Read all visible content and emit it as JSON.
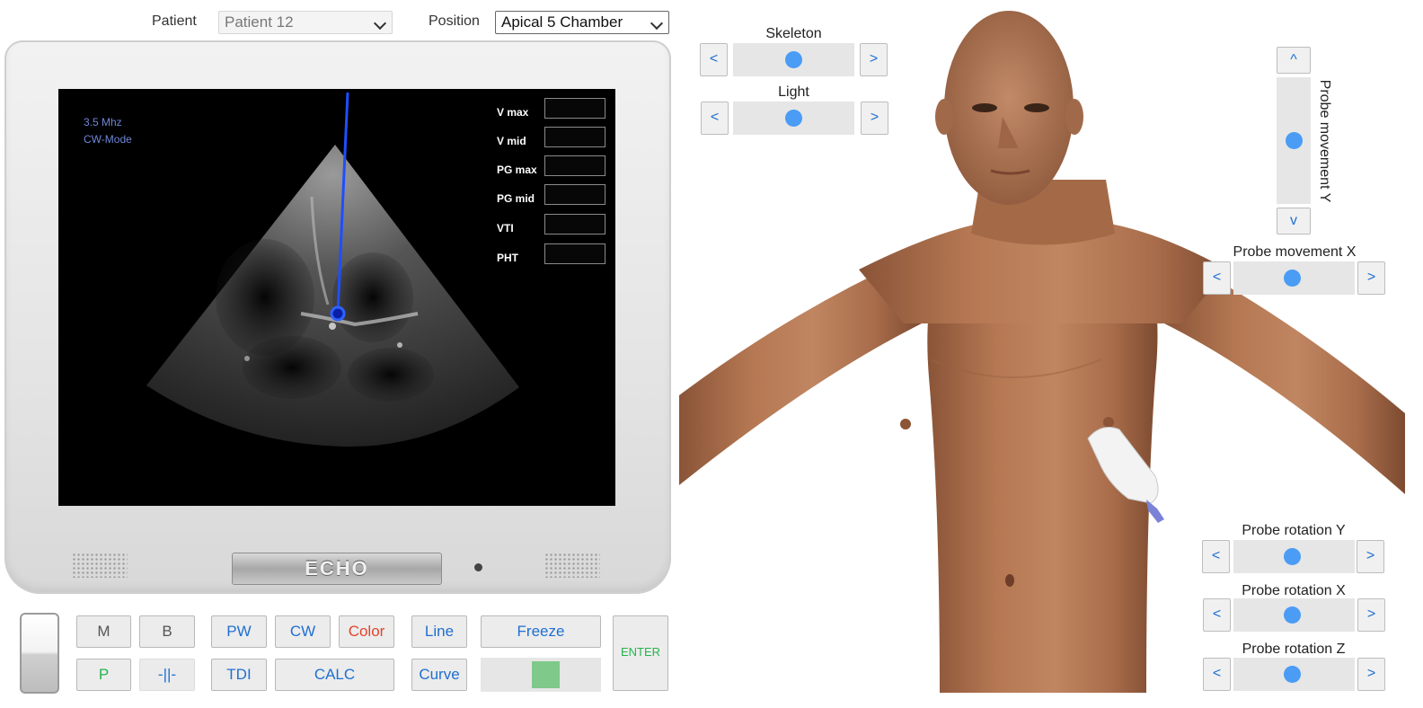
{
  "header": {
    "patient_label": "Patient",
    "patient_value": "Patient 12",
    "position_label": "Position",
    "position_value": "Apical 5 Chamber"
  },
  "screen": {
    "frequency": "3.5 Mhz",
    "mode": "CW-Mode",
    "measurements": [
      {
        "label": "V max",
        "value": ""
      },
      {
        "label": "V mid",
        "value": ""
      },
      {
        "label": "PG max",
        "value": ""
      },
      {
        "label": "PG mid",
        "value": ""
      },
      {
        "label": "VTI",
        "value": ""
      },
      {
        "label": "PHT",
        "value": ""
      }
    ]
  },
  "monitor": {
    "brand": "ECHO"
  },
  "buttons": {
    "m": "M",
    "b": "B",
    "pw": "PW",
    "cw": "CW",
    "color": "Color",
    "line": "Line",
    "freeze": "Freeze",
    "enter": "ENTER",
    "p": "P",
    "sep": "-||-",
    "tdi": "TDI",
    "calc": "CALC",
    "curve": "Curve"
  },
  "controls": {
    "skeleton": "Skeleton",
    "light": "Light",
    "probe_movement_y": "Probe movement Y",
    "probe_movement_x": "Probe movement X",
    "probe_rotation_y": "Probe rotation Y",
    "probe_rotation_x": "Probe rotation X",
    "probe_rotation_z": "Probe rotation Z",
    "left": "<",
    "right": ">",
    "up": "^",
    "down": "v"
  },
  "colors": {
    "accent": "#1f6fd1",
    "knob": "#4a9cf5",
    "color_button": "#e2452b",
    "green": "#24b54b",
    "skin": "#b67a56"
  }
}
